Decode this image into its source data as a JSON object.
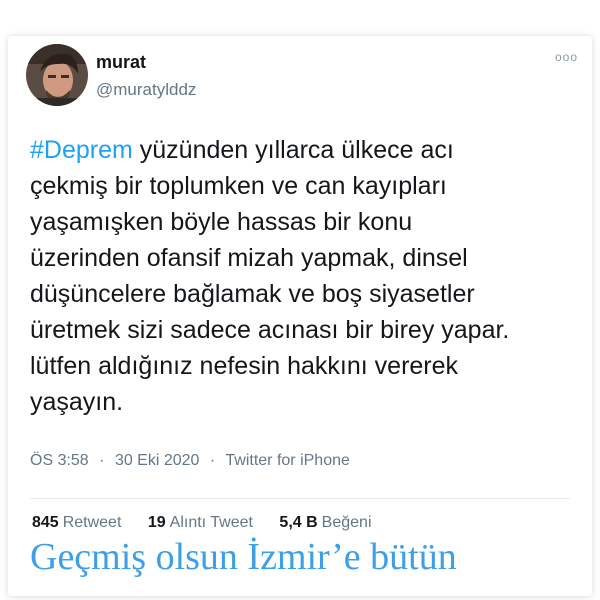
{
  "user": {
    "name": "murat",
    "handle": "@muratylddz"
  },
  "tweet": {
    "hashtag": "#Deprem",
    "line1_rest": " yüzünden yıllarca ülkece acı",
    "lines": [
      "çekmiş bir toplumken ve can kayıpları",
      "yaşamışken böyle hassas bir konu",
      "üzerinden ofansif mizah yapmak, dinsel",
      "düşüncelere bağlamak ve boş siyasetler",
      "üretmek sizi sadece acınası bir birey yapar.",
      "lütfen aldığınız nefesin hakkını vererek",
      "yaşayın."
    ]
  },
  "meta": {
    "time": "ÖS 3:58",
    "separator": "·",
    "date": "30 Eki 2020",
    "source": "Twitter for iPhone"
  },
  "stats": {
    "retweets_count": "845",
    "retweets_label": "Retweet",
    "quotes_count": "19",
    "quotes_label": "Alıntı Tweet",
    "likes_count": "5,4 B",
    "likes_label": "Beğeni"
  },
  "more_menu": "ooo",
  "caption": {
    "line1": "Geçmiş olsun İzmir’e bütün"
  },
  "colors": {
    "hashtag": "#1da1f2",
    "caption": "#3f9fe6",
    "secondary_text": "#657786"
  },
  "icons": {
    "more": "more-options-icon",
    "avatar": "user-avatar"
  }
}
